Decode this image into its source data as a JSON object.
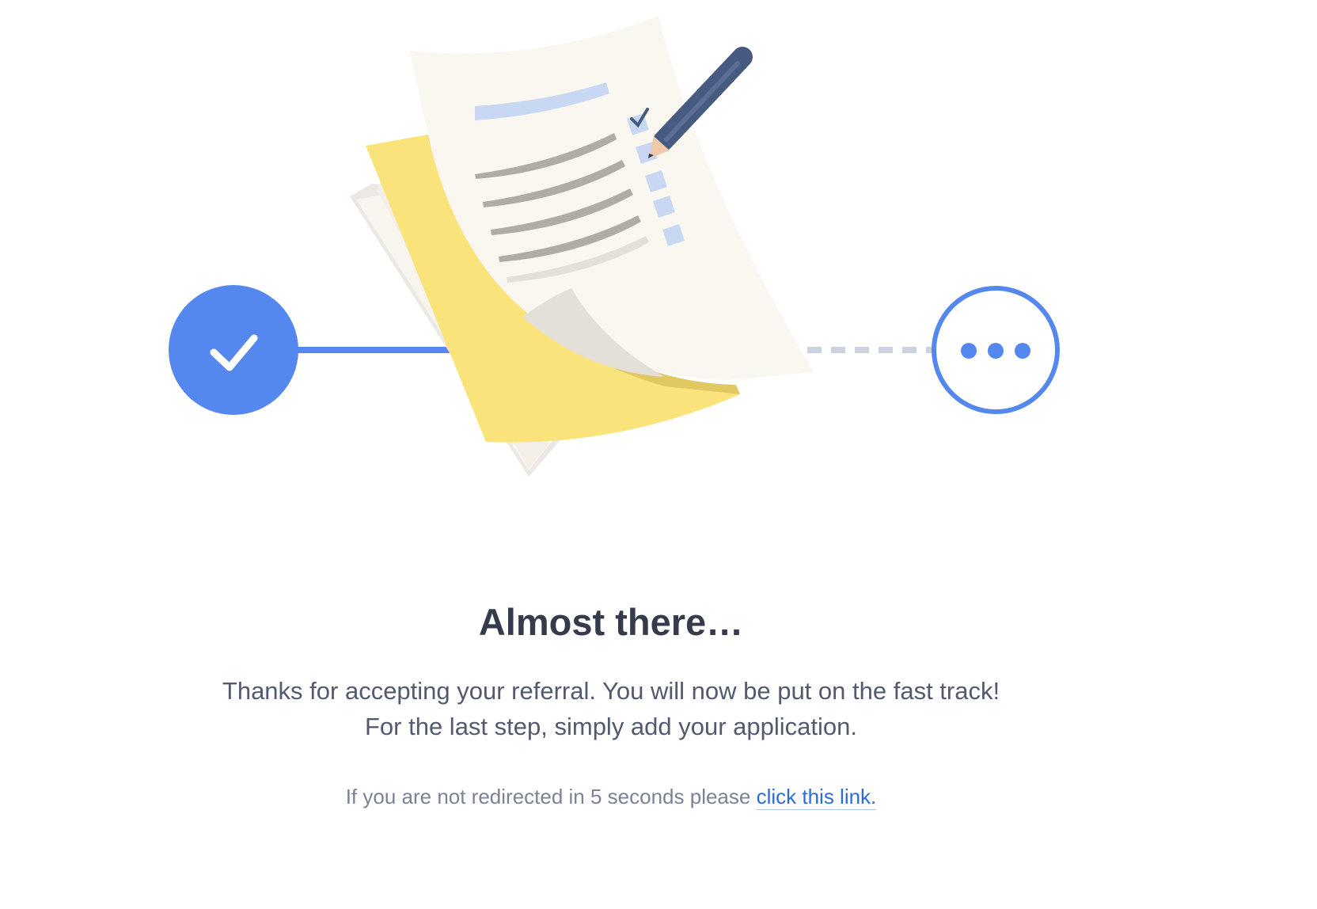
{
  "heading": "Almost there…",
  "message": {
    "line1": "Thanks for accepting your referral. You will now be put on the fast track!",
    "line2": "For the last step, simply add your application."
  },
  "redirect": {
    "text": "If you are not redirected in 5 seconds please ",
    "link_label": "click this link."
  },
  "progress": {
    "step_completed_icon": "checkmark-icon",
    "step_pending_icon": "ellipsis-icon"
  },
  "colors": {
    "accent_blue": "#5588ee",
    "heading": "#353b4b",
    "body_text": "#525a6e",
    "muted_text": "#7b8294",
    "link": "#2d6bd6",
    "paper_yellow": "#f9e37a",
    "paper_cream": "#faf6f0",
    "pencil": "#475b80"
  }
}
